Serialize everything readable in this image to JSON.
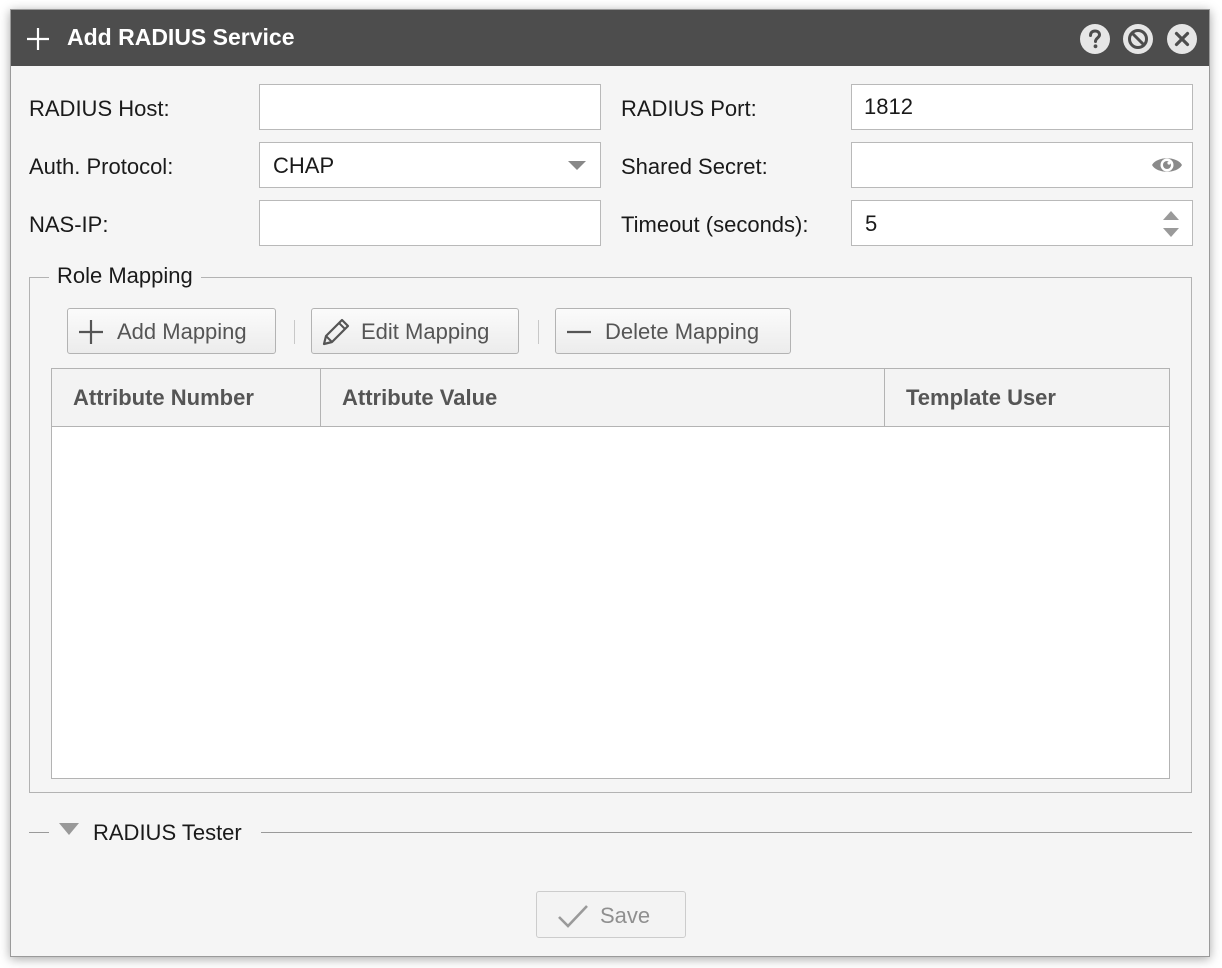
{
  "window": {
    "title": "Add RADIUS Service",
    "help_icon": "question-circle-icon",
    "minimize_icon": "no-entry-icon",
    "close_icon": "close-circle-icon"
  },
  "form": {
    "radius_host": {
      "label": "RADIUS Host:",
      "value": ""
    },
    "radius_port": {
      "label": "RADIUS Port:",
      "value": "1812"
    },
    "auth_protocol": {
      "label": "Auth. Protocol:",
      "value": "CHAP"
    },
    "shared_secret": {
      "label": "Shared Secret:",
      "value": ""
    },
    "nas_ip": {
      "label": "NAS-IP:",
      "value": ""
    },
    "timeout": {
      "label": "Timeout (seconds):",
      "value": "5"
    }
  },
  "role_mapping": {
    "legend": "Role Mapping",
    "toolbar": {
      "add_label": "Add Mapping",
      "edit_label": "Edit Mapping",
      "delete_label": "Delete Mapping"
    },
    "columns": [
      "Attribute Number",
      "Attribute Value",
      "Template User"
    ],
    "rows": []
  },
  "tester": {
    "label": "RADIUS Tester"
  },
  "footer": {
    "save_label": "Save"
  },
  "colors": {
    "titlebar": "#4d4d4d",
    "panel": "#f5f5f5",
    "border": "#b3b3b3",
    "muted_text": "#555555"
  }
}
